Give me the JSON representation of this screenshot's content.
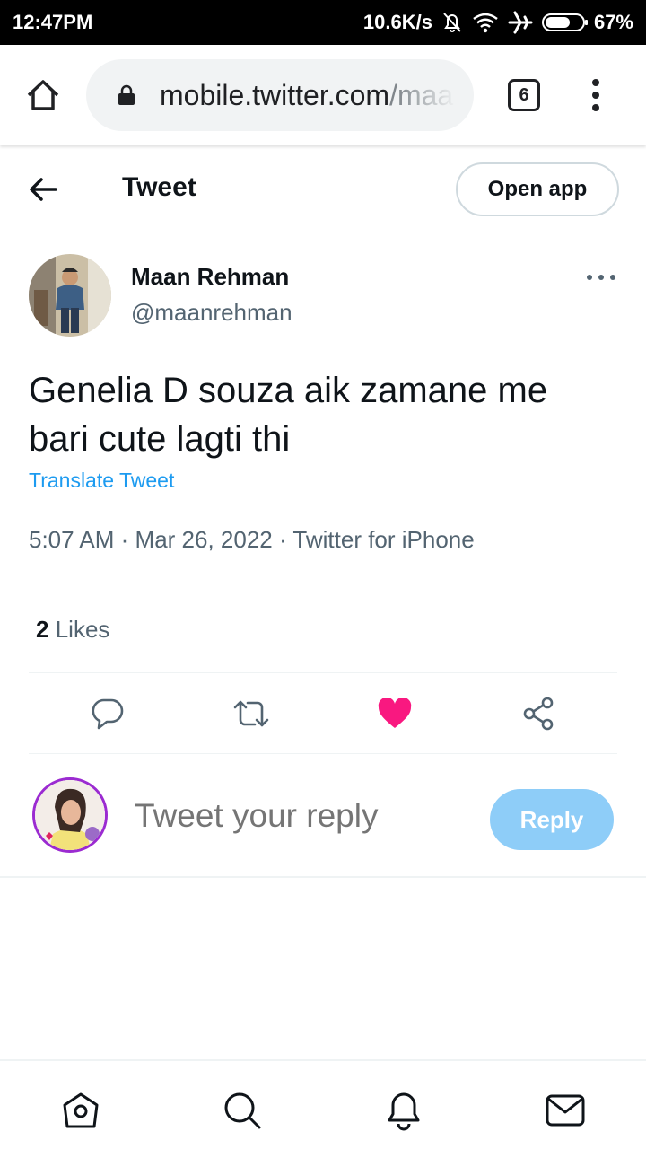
{
  "status_bar": {
    "time": "12:47PM",
    "network_speed": "10.6K/s",
    "battery": "67%",
    "battery_level": 0.67
  },
  "browser": {
    "url_host": "mobile.twitter.com",
    "url_path": "/maanrehman",
    "tab_count": "6"
  },
  "header": {
    "title": "Tweet",
    "open_app_label": "Open app"
  },
  "tweet": {
    "author_name": "Maan Rehman",
    "author_handle": "@maanrehman",
    "text": "Genelia D souza aik zamane me bari cute lagti thi",
    "translate_label": "Translate Tweet",
    "time": "5:07 AM",
    "date": "Mar 26, 2022",
    "source": "Twitter for iPhone",
    "likes_count": "2",
    "likes_label": "Likes",
    "liked": true
  },
  "reply": {
    "placeholder": "Tweet your reply",
    "button_label": "Reply"
  },
  "colors": {
    "accent": "#1d9bf0",
    "like": "#f91880",
    "reply_disabled": "#8ecdf8",
    "secondary_text": "#536471"
  },
  "icons": {
    "actions": [
      "reply-icon",
      "retweet-icon",
      "like-icon",
      "share-icon"
    ],
    "nav": [
      "home-icon",
      "search-icon",
      "notifications-icon",
      "messages-icon"
    ]
  }
}
